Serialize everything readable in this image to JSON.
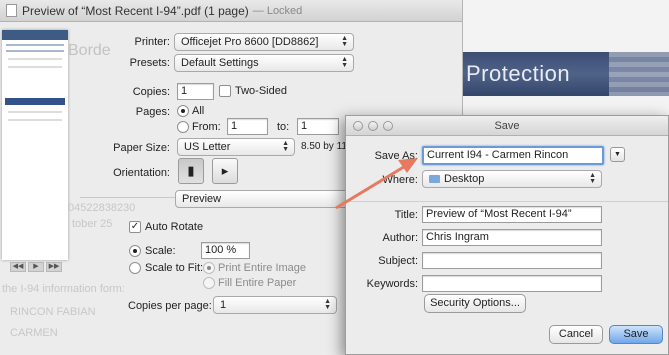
{
  "background": {
    "banner_text": "Protection",
    "faded_texts": [
      "Borde",
      "04522838230",
      "tober 25",
      "the I-94 information form:",
      "RINCON FABIAN",
      "CARMEN"
    ]
  },
  "print_dialog": {
    "window_title": "Preview of “Most Recent I-94”.pdf (1 page)",
    "locked_suffix": "— Locked",
    "thumb_nav": [
      "◀◀",
      "▶",
      "▶▶"
    ],
    "printer_label": "Printer:",
    "printer_value": "Officejet Pro 8600 [DD8862]",
    "presets_label": "Presets:",
    "presets_value": "Default Settings",
    "copies_label": "Copies:",
    "copies_value": "1",
    "two_sided_label": "Two-Sided",
    "pages_label": "Pages:",
    "pages_all": "All",
    "pages_from": "From:",
    "pages_from_value": "1",
    "pages_to": "to:",
    "pages_to_value": "1",
    "paper_size_label": "Paper Size:",
    "paper_size_value": "US Letter",
    "paper_size_dims": "8.50 by 11",
    "orientation_label": "Orientation:",
    "section_popup": "Preview",
    "auto_rotate_label": "Auto Rotate",
    "scale_label": "Scale:",
    "scale_value": "100 %",
    "scale_to_fit_label": "Scale to Fit:",
    "print_entire_image": "Print Entire Image",
    "fill_entire_paper": "Fill Entire Paper",
    "copies_per_page_label": "Copies per page:",
    "copies_per_page_value": "1"
  },
  "save_dialog": {
    "title": "Save",
    "save_as_label": "Save As:",
    "save_as_value": "Current I94 - Carmen Rincon",
    "where_label": "Where:",
    "where_value": "Desktop",
    "title_label": "Title:",
    "title_value": "Preview of “Most Recent I-94”",
    "author_label": "Author:",
    "author_value": "Chris Ingram",
    "subject_label": "Subject:",
    "subject_value": "",
    "keywords_label": "Keywords:",
    "keywords_value": "",
    "security_button": "Security Options...",
    "cancel_button": "Cancel",
    "save_button": "Save"
  },
  "colors": {
    "arrow": "#e77a5e",
    "focus_ring": "#6c9ad8",
    "primary_button": "#6fa7ea"
  }
}
